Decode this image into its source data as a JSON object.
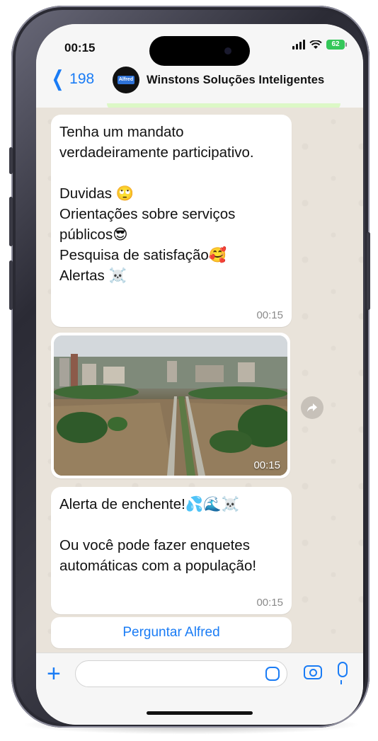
{
  "status_bar": {
    "time": "00:15",
    "battery": "62"
  },
  "header": {
    "back_count": "198",
    "chat_name": "Winstons Soluções Inteligentes",
    "avatar_text": "Alfred"
  },
  "messages": [
    {
      "text": "Tenha um mandato verdadeiramente participativo.\n\nDuvidas 🙄\nOrientações sobre serviços públicos😎\nPesquisa de satisfação🥰\nAlertas ☠️",
      "time": "00:15"
    },
    {
      "image_alt": "flooded city street",
      "time": "00:15"
    },
    {
      "text": "Alerta de enchente!💦🌊☠️\n\nOu você pode fazer enquetes automáticas com a população!",
      "time": "00:15"
    }
  ],
  "quick_reply": "Perguntar Alfred",
  "colors": {
    "accent": "#1a7cf5",
    "chat_bg": "#e9e3da",
    "bubble": "#ffffff"
  }
}
